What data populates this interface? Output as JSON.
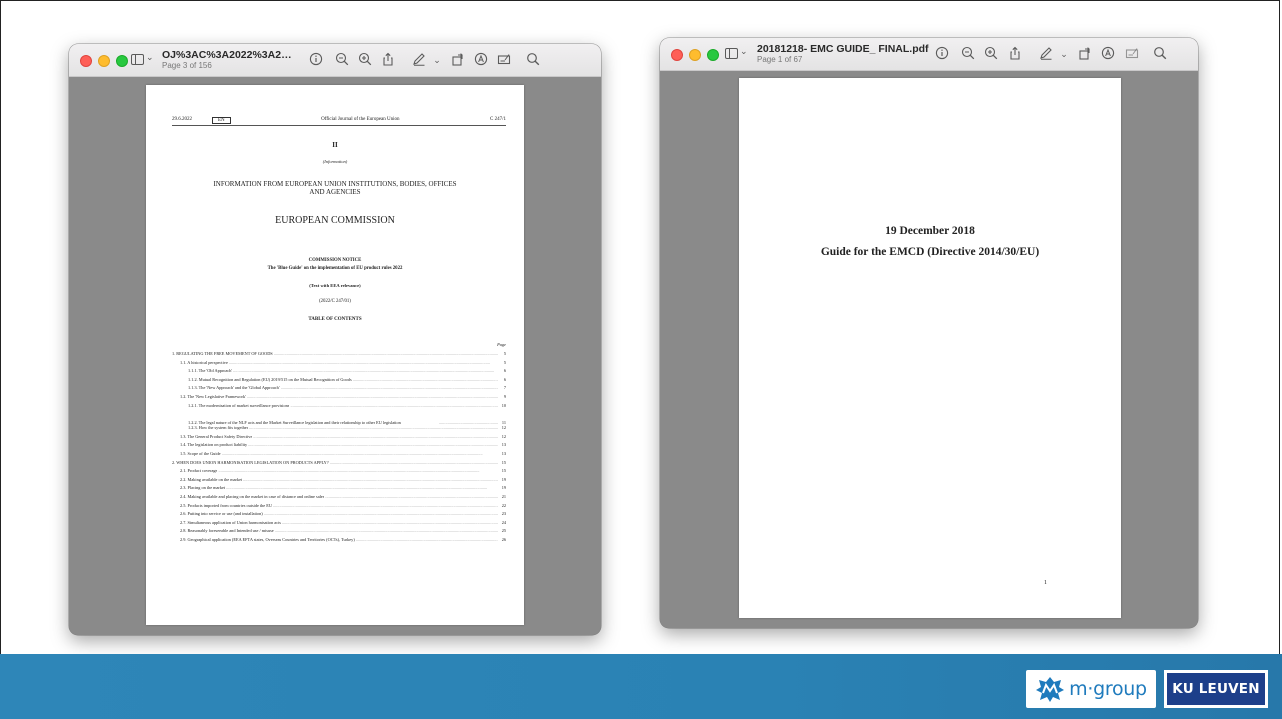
{
  "window_left": {
    "title": "OJ%3AC%3A2022%3A247%3AFULL...",
    "subtitle": "Page 3 of 156",
    "page": {
      "date": "29.6.2022",
      "lang": "EN",
      "journal": "Official Journal of the European Union",
      "ref": "C 247/1",
      "roman": "II",
      "info": "(Information)",
      "heading1": "INFORMATION FROM EUROPEAN UNION INSTITUTIONS, BODIES, OFFICES",
      "heading2": "AND AGENCIES",
      "commission": "EUROPEAN COMMISSION",
      "notice": "COMMISSION NOTICE",
      "notice_title": "The 'Blue Guide' on the implementation of EU product rules 2022",
      "eea": "(Text with EEA relevance)",
      "code": "(2022/C 247/01)",
      "toc_title": "TABLE OF CONTENTS",
      "page_label": "Page",
      "toc": [
        {
          "label": "1.   REGULATING THE FREE MOVEMENT OF GOODS",
          "page": "5",
          "indent": 0
        },
        {
          "label": "1.1.   A historical perspective",
          "page": "5",
          "indent": 1
        },
        {
          "label": "1.1.1.   The 'Old Approach'",
          "page": "6",
          "indent": 2
        },
        {
          "label": "1.1.2.   Mutual Recognition and Regulation (EU) 2019/515 on the Mutual Recognition of Goods",
          "page": "6",
          "indent": 2
        },
        {
          "label": "1.1.3.   The 'New Approach' and the 'Global Approach'",
          "page": "7",
          "indent": 2
        },
        {
          "label": "1.2.   The 'New Legislative Framework'",
          "page": "9",
          "indent": 1
        },
        {
          "label": "1.2.1.   The modernisation of market surveillance provisions",
          "page": "10",
          "indent": 2
        },
        {
          "label": "1.2.2.   The legal nature of the NLF acts and the Market Surveillance legislation and their relationship to other EU legislation",
          "page": "11",
          "indent": 2,
          "multi": true
        },
        {
          "label": "1.2.3.   How the system fits together",
          "page": "12",
          "indent": 2
        },
        {
          "label": "1.3.   The General Product Safety Directive",
          "page": "12",
          "indent": 1
        },
        {
          "label": "1.4.   The legislation on product liability",
          "page": "13",
          "indent": 1
        },
        {
          "label": "1.5.   Scope of the Guide",
          "page": "13",
          "indent": 1
        },
        {
          "label": "2.   WHEN DOES UNION HARMONISATION LEGISLATION ON PRODUCTS APPLY?",
          "page": "15",
          "indent": 0
        },
        {
          "label": "2.1.   Product coverage",
          "page": "15",
          "indent": 1
        },
        {
          "label": "2.2.   Making available on the market",
          "page": "19",
          "indent": 1
        },
        {
          "label": "2.3.   Placing on the market",
          "page": "19",
          "indent": 1
        },
        {
          "label": "2.4.   Making available and placing on the market in case of distance and online sales",
          "page": "21",
          "indent": 1
        },
        {
          "label": "2.5.   Products imported from countries outside the EU",
          "page": "22",
          "indent": 1
        },
        {
          "label": "2.6.   Putting into service or use (and installation)",
          "page": "23",
          "indent": 1
        },
        {
          "label": "2.7.   Simultaneous application of Union harmonisation acts",
          "page": "24",
          "indent": 1
        },
        {
          "label": "2.8.   Reasonably foreseeable and Intended use / misuse",
          "page": "25",
          "indent": 1
        },
        {
          "label": "2.9.   Geographical application (EEA EFTA states, Overseas Countries and Territories (OCTs), Turkey)",
          "page": "26",
          "indent": 1
        }
      ]
    }
  },
  "window_right": {
    "title": "20181218- EMC GUIDE_ FINAL.pdf",
    "subtitle": "Page 1 of 67",
    "page": {
      "line1": "19 December 2018",
      "line2": "Guide for the EMCD (Directive 2014/30/EU)",
      "page_number": "1"
    }
  },
  "toolbar_icons": [
    "sidebar-icon",
    "info-icon",
    "zoom-out-icon",
    "zoom-in-icon",
    "share-icon",
    "markup-icon",
    "chevron-down-icon",
    "rotate-icon",
    "annotate-icon",
    "form-icon",
    "search-icon"
  ],
  "footer": {
    "logo1": "m·group",
    "logo2": "KU LEUVEN"
  },
  "colors": {
    "footer_band": "#2e86b8",
    "ku_blue": "#1d3f8a",
    "mgroup_blue": "#1f7bbd"
  }
}
